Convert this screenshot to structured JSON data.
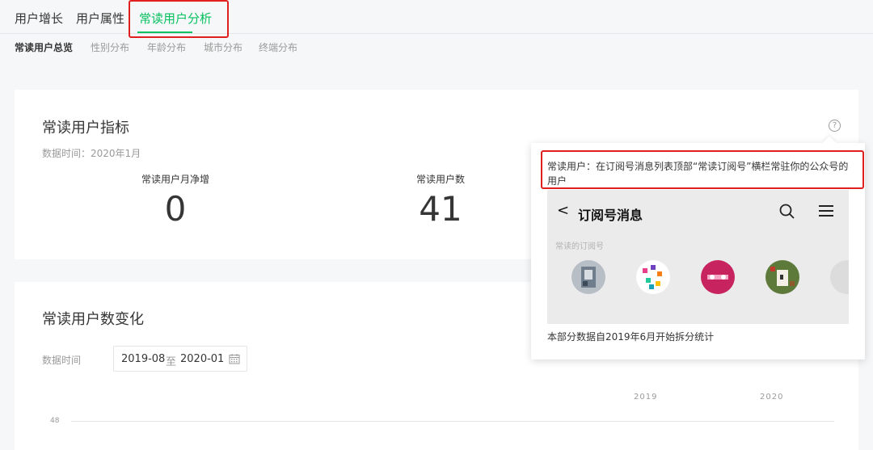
{
  "top_tabs": [
    "用户增长",
    "用户属性",
    "常读用户分析"
  ],
  "sub_tabs": [
    "常读用户总览",
    "性别分布",
    "年龄分布",
    "城市分布",
    "终端分布"
  ],
  "metrics_card": {
    "title": "常读用户指标",
    "data_time": "数据时间：2020年1月",
    "help_glyph": "?",
    "metrics": [
      {
        "label": "常读用户月净增",
        "value": "0"
      },
      {
        "label": "常读用户数",
        "value": "41"
      }
    ]
  },
  "trend_card": {
    "title": "常读用户数变化",
    "date_label": "数据时间",
    "date_start": "2019-08",
    "date_sep": "至",
    "date_end": "2020-01",
    "years": [
      "2019",
      "2020"
    ],
    "y_tick": "48"
  },
  "popup": {
    "description": "常读用户：在订阅号消息列表顶部“常读订阅号”横栏常驻你的公众号的用户",
    "mock_back": "<",
    "mock_title": "订阅号消息",
    "mock_section": "常读的订阅号",
    "footer": "本部分数据自2019年6月开始拆分统计"
  },
  "colors": {
    "accent": "#07c160",
    "highlight_box": "#e02020"
  }
}
